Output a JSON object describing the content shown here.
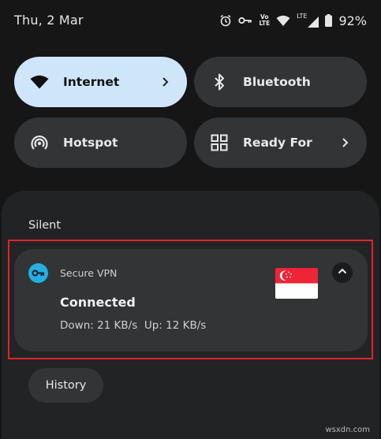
{
  "status_bar": {
    "date": "Thu, 2 Mar",
    "icons": [
      "alarm-icon",
      "vpn-key-icon",
      "volte-icon",
      "wifi-icon",
      "lte-signal-icon",
      "battery-icon"
    ],
    "volte_top": "Vo",
    "volte_bottom": "LTE",
    "lte_label": "LTE",
    "battery_percent": "92%"
  },
  "tiles": {
    "internet": {
      "label": "Internet",
      "icon": "wifi-icon",
      "active": true
    },
    "bluetooth": {
      "label": "Bluetooth",
      "icon": "bluetooth-icon",
      "active": false
    },
    "hotspot": {
      "label": "Hotspot",
      "icon": "hotspot-icon",
      "active": false
    },
    "ready_for": {
      "label": "Ready For",
      "icon": "grid-icon",
      "active": false
    }
  },
  "notifications": {
    "section_label": "Silent",
    "vpn": {
      "app_name": "Secure VPN",
      "title": "Connected",
      "text": "Down: 21 KB/s  Up: 12 KB/s",
      "flag": "singapore-flag",
      "expand_icon": "chevron-up-icon"
    },
    "history_label": "History"
  },
  "watermark": "wsxdn.com",
  "colors": {
    "background": "#161616",
    "tile": "#323436",
    "tile_active": "#cfe6fa",
    "shade": "#222325",
    "highlight": "#e2232b",
    "app_icon": "#25aee0",
    "flag_red": "#ee2536"
  }
}
